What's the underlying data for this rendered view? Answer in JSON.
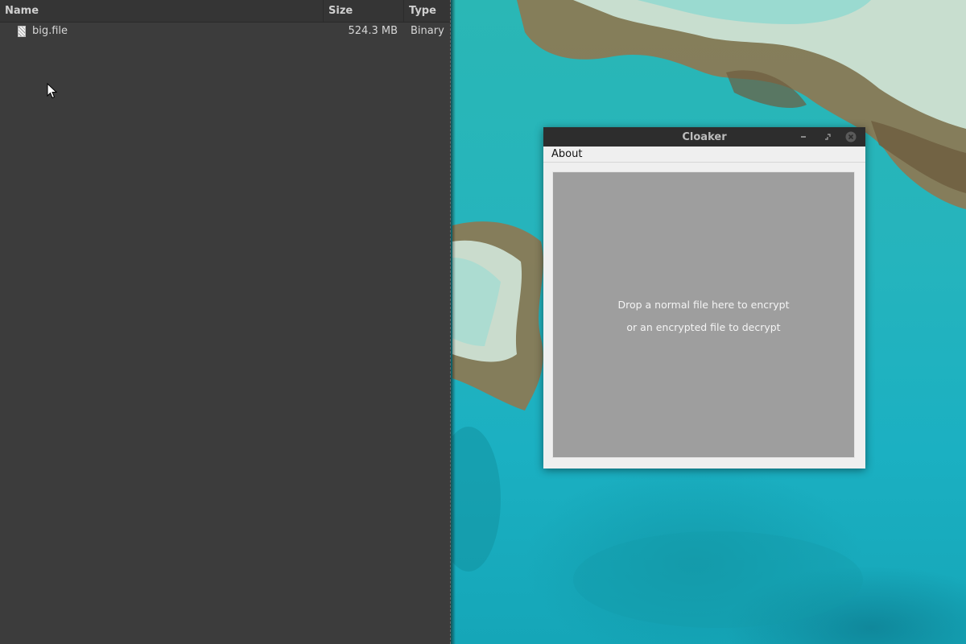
{
  "file_manager": {
    "columns": {
      "name": "Name",
      "size": "Size",
      "type": "Type"
    },
    "files": [
      {
        "icon": "binary-file-icon",
        "name": "big.file",
        "size": "524.3 MB",
        "type": "Binary"
      }
    ]
  },
  "cloaker_window": {
    "title": "Cloaker",
    "menu": {
      "about": "About"
    },
    "drop_zone": {
      "line1": "Drop a normal file here to encrypt",
      "line2": "or an encrypted file to decrypt"
    }
  },
  "colors": {
    "file_pane_bg": "#3c3c3c",
    "titlebar_bg": "#2d2d2d",
    "drop_zone_bg": "#9e9e9e",
    "wallpaper_water": "#1fb3bd"
  }
}
